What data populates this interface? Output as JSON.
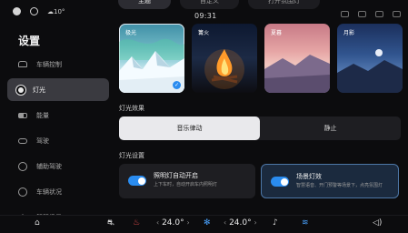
{
  "status_bar": {
    "temperature": "10°",
    "time": "09:31"
  },
  "top_tabs": [
    {
      "label": "主题",
      "active": true
    },
    {
      "label": "自定义",
      "active": false
    },
    {
      "label": "打开氛围灯",
      "active": false
    }
  ],
  "sidebar": {
    "title": "设置",
    "items": [
      {
        "label": "车辆控制",
        "icon": "car-icon",
        "active": false
      },
      {
        "label": "灯光",
        "icon": "bulb-icon",
        "active": true
      },
      {
        "label": "能量",
        "icon": "battery-icon",
        "active": false
      },
      {
        "label": "驾驶",
        "icon": "drive-icon",
        "active": false
      },
      {
        "label": "辅助驾驶",
        "icon": "assist-icon",
        "active": false
      },
      {
        "label": "车辆状况",
        "icon": "status-icon",
        "active": false
      },
      {
        "label": "智慧场景",
        "icon": "smart-icon",
        "active": false
      }
    ]
  },
  "theme_cards": [
    {
      "label": "极光",
      "selected": true
    },
    {
      "label": "篝火",
      "selected": false
    },
    {
      "label": "夏暮",
      "selected": false
    },
    {
      "label": "月影",
      "selected": false
    }
  ],
  "light_effect": {
    "title": "灯光效果",
    "options": [
      {
        "label": "音乐律动",
        "active": true
      },
      {
        "label": "静止",
        "active": false
      }
    ]
  },
  "light_settings": {
    "title": "灯光设置",
    "cards": [
      {
        "title": "照明灯自动开启",
        "desc": "上下车时，自动开启车内照明灯",
        "on": true
      },
      {
        "title": "场景灯效",
        "desc": "智慧语音、开门预警等场景下，点亮氛围灯",
        "on": true
      }
    ]
  },
  "dock": {
    "left_temp": "24.0°",
    "right_temp": "24.0°"
  }
}
